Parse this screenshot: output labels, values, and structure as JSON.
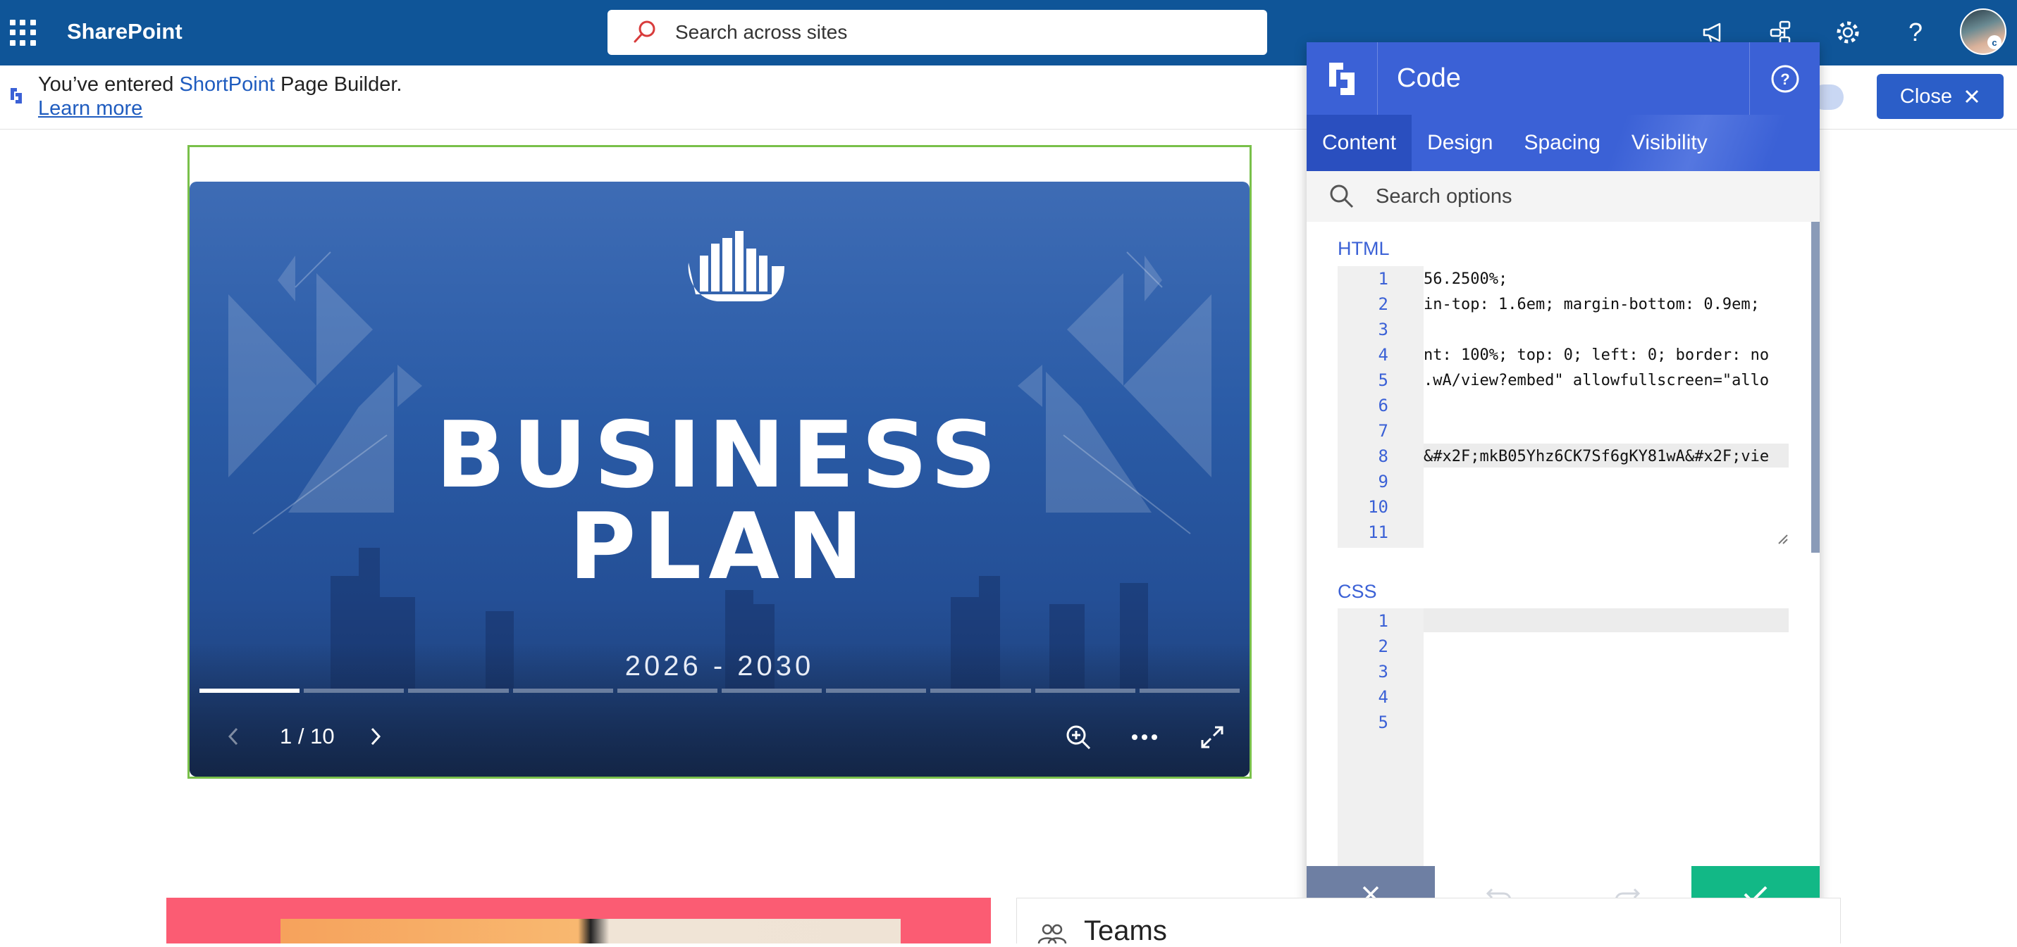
{
  "app": {
    "name": "SharePoint"
  },
  "search": {
    "placeholder": "Search across sites"
  },
  "notice": {
    "prefix": "You’ve entered ",
    "brand": "ShortPoint",
    "suffix": " Page Builder.",
    "learn_more": "Learn more",
    "close_label": "Close"
  },
  "slide": {
    "title_line1": "BUSINESS",
    "title_line2": "PLAN",
    "years": "2026 - 2030",
    "page_indicator": "1 / 10",
    "current_page": 1,
    "total_pages": 10
  },
  "panel": {
    "title": "Code",
    "tabs": [
      {
        "label": "Content",
        "active": true
      },
      {
        "label": "Design",
        "active": false
      },
      {
        "label": "Spacing",
        "active": false
      },
      {
        "label": "Visibility",
        "active": false
      }
    ],
    "search_placeholder": "Search options",
    "html_label": "HTML",
    "css_label": "CSS",
    "html_lines": [
      {
        "n": "1",
        "text": "56.2500%;"
      },
      {
        "n": "2",
        "text": "in-top: 1.6em; margin-bottom: 0.9em;"
      },
      {
        "n": "3",
        "text": ""
      },
      {
        "n": "4",
        "text": "nt: 100%; top: 0; left: 0; border: no"
      },
      {
        "n": "5",
        "text": ".wA/view?embed\" allowfullscreen=\"allo"
      },
      {
        "n": "6",
        "text": ""
      },
      {
        "n": "7",
        "text": ""
      },
      {
        "n": "8",
        "text": "&#x2F;mkB05Yhz6CK7Sf6gKY81wA&#x2F;vie"
      },
      {
        "n": "9",
        "text": ""
      },
      {
        "n": "10",
        "text": ""
      },
      {
        "n": "11",
        "text": ""
      }
    ],
    "css_lines": [
      "1",
      "2",
      "3",
      "4",
      "5"
    ]
  },
  "teams": {
    "title": "Teams"
  },
  "colors": {
    "topbar": "#0f5598",
    "panel_accent": "#3b61d6",
    "confirm": "#12b886",
    "slide_frame": "#79c04a"
  },
  "icons": [
    "waffle-icon",
    "search-icon",
    "megaphone-icon",
    "org-chart-icon",
    "gear-icon",
    "help-icon",
    "shortpoint-logo-icon",
    "close-icon",
    "zoom-in-icon",
    "more-icon",
    "fullscreen-icon",
    "undo-icon",
    "redo-icon",
    "check-icon"
  ]
}
